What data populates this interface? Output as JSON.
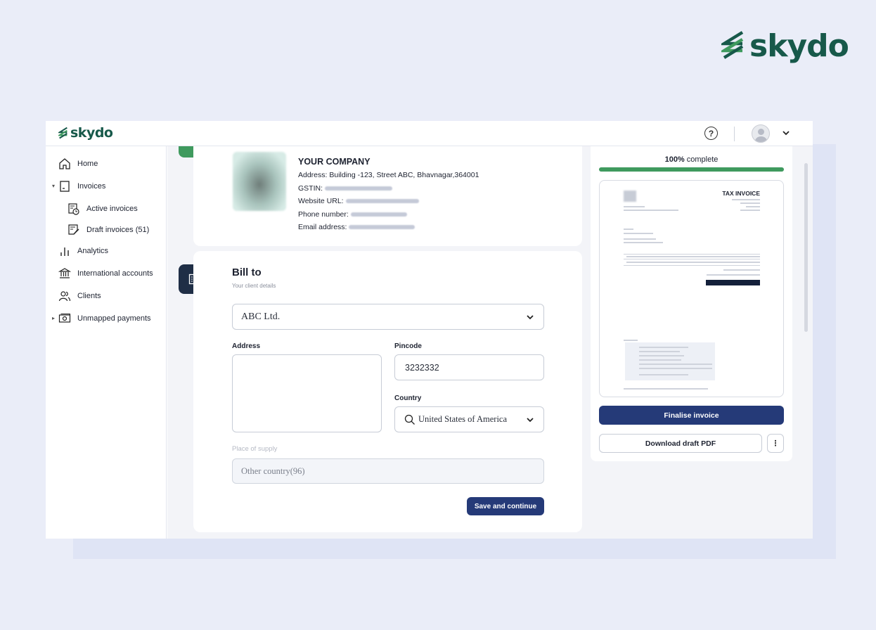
{
  "brand": {
    "name": "skydo",
    "color": "#17594a"
  },
  "topbar": {
    "help_icon": "?"
  },
  "sidebar": {
    "items": [
      {
        "label": "Home",
        "icon": "home-icon"
      },
      {
        "label": "Invoices",
        "icon": "invoice-icon"
      },
      {
        "label": "Active invoices",
        "icon": "active-invoice-icon"
      },
      {
        "label": "Draft invoices (51)",
        "icon": "draft-invoice-icon"
      },
      {
        "label": "Analytics",
        "icon": "analytics-icon"
      },
      {
        "label": "International accounts",
        "icon": "bank-icon"
      },
      {
        "label": "Clients",
        "icon": "clients-icon"
      },
      {
        "label": "Unmapped payments",
        "icon": "cash-icon"
      }
    ]
  },
  "company": {
    "name": "YOUR COMPANY",
    "address": "Address: Building -123, Street ABC, Bhavnagar,364001",
    "gstin_label": "GSTIN:",
    "website_label": "Website URL:",
    "phone_label": "Phone number:",
    "email_label": "Email address:"
  },
  "bill_to": {
    "title": "Bill to",
    "subtitle": "Your client details",
    "client": "ABC Ltd.",
    "address_label": "Address",
    "address_value": "",
    "pincode_label": "Pincode",
    "pincode_value": "3232332",
    "country_label": "Country",
    "country_value": "United States of America",
    "place_of_supply_label": "Place of supply",
    "place_of_supply_value": "Other country(96)",
    "save_label": "Save and continue"
  },
  "preview": {
    "progress_percent": 100,
    "progress_strong": "100%",
    "progress_text": " complete",
    "title": "TAX INVOICE",
    "finalise_label": "Finalise invoice",
    "download_label": "Download draft PDF",
    "more_label": "⋮"
  },
  "colors": {
    "accent_green": "#3f9a5e",
    "primary_navy": "#253a78",
    "dark_icon_bg": "#1f2e46"
  }
}
